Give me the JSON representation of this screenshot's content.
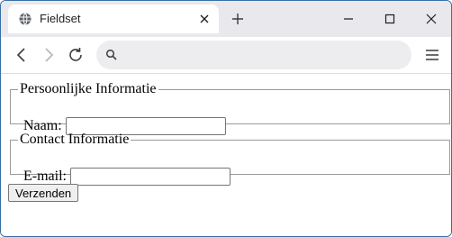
{
  "browser": {
    "tab_title": "Fieldset",
    "omnibox_value": ""
  },
  "icons": {
    "favicon": "globe-icon",
    "tab_close": "close-icon",
    "new_tab": "plus-icon",
    "minimize": "minimize-icon",
    "maximize": "maximize-icon",
    "close_window": "close-icon",
    "back": "arrow-left-icon",
    "forward": "arrow-right-icon",
    "reload": "reload-icon",
    "search": "search-icon",
    "menu": "hamburger-menu-icon"
  },
  "form": {
    "personal": {
      "legend": "Persoonlijke Informatie",
      "name_label": "Naam:",
      "name_value": ""
    },
    "contact": {
      "legend": "Contact Informatie",
      "email_label": "E-mail:",
      "email_value": ""
    },
    "submit_label": "Verzenden"
  },
  "colors": {
    "tabstrip_bg": "#e8e8ed",
    "window_border": "#3a6ea5",
    "fieldset_border": "#9a9a9a"
  }
}
